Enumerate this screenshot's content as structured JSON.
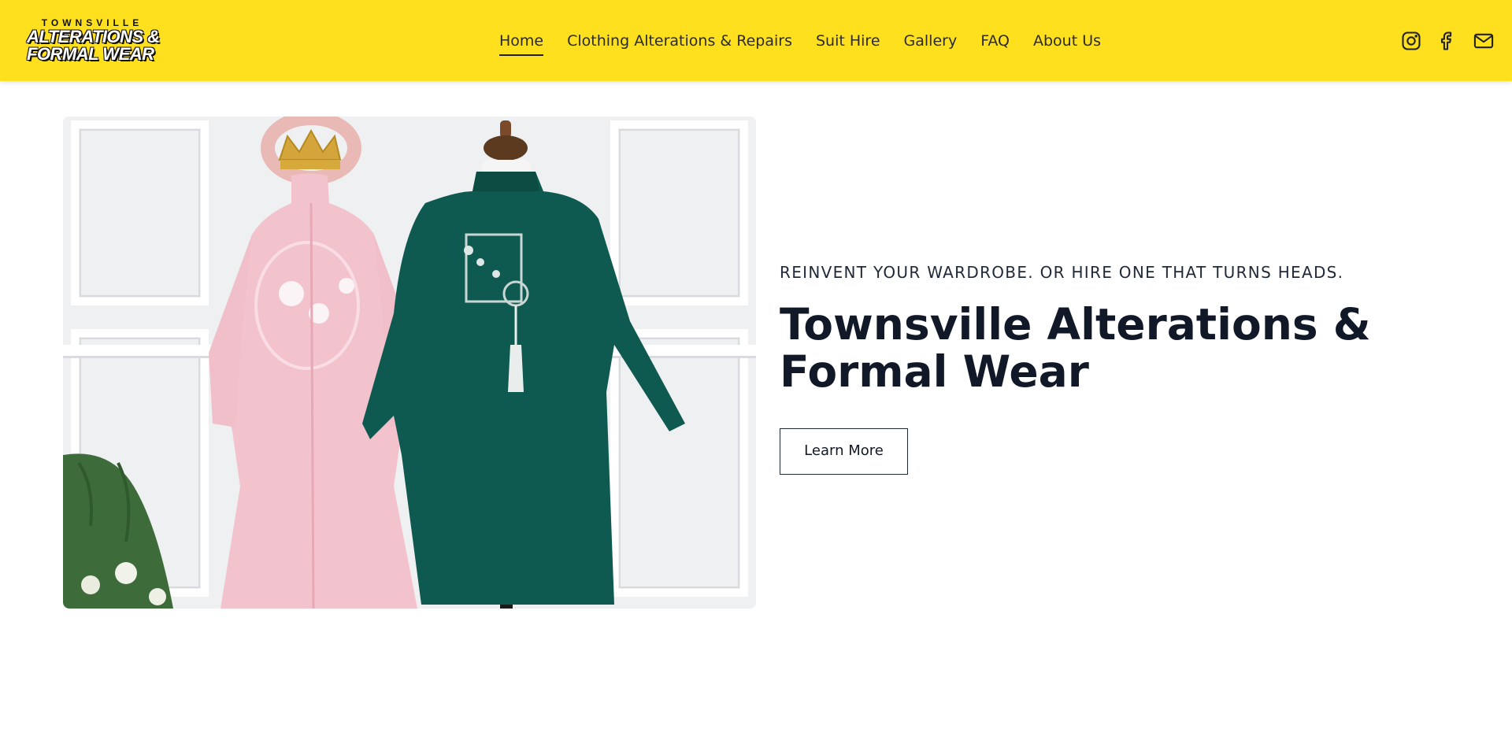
{
  "header": {
    "logo": {
      "top": "TOWNSVILLE",
      "line1": "ALTERATIONS &",
      "line2": "FORMAL WEAR"
    },
    "nav": [
      {
        "label": "Home",
        "active": true
      },
      {
        "label": "Clothing Alterations & Repairs",
        "active": false
      },
      {
        "label": "Suit Hire",
        "active": false
      },
      {
        "label": "Gallery",
        "active": false
      },
      {
        "label": "FAQ",
        "active": false
      },
      {
        "label": "About Us",
        "active": false
      }
    ],
    "social_icons": [
      "instagram-icon",
      "facebook-icon",
      "mail-icon"
    ],
    "background_color": "#ffe01f"
  },
  "hero": {
    "eyebrow": "REINVENT YOUR WARDROBE. OR HIRE ONE THAT TURNS HEADS.",
    "title": "Townsville Alterations & Formal Wear",
    "cta_label": "Learn More"
  }
}
